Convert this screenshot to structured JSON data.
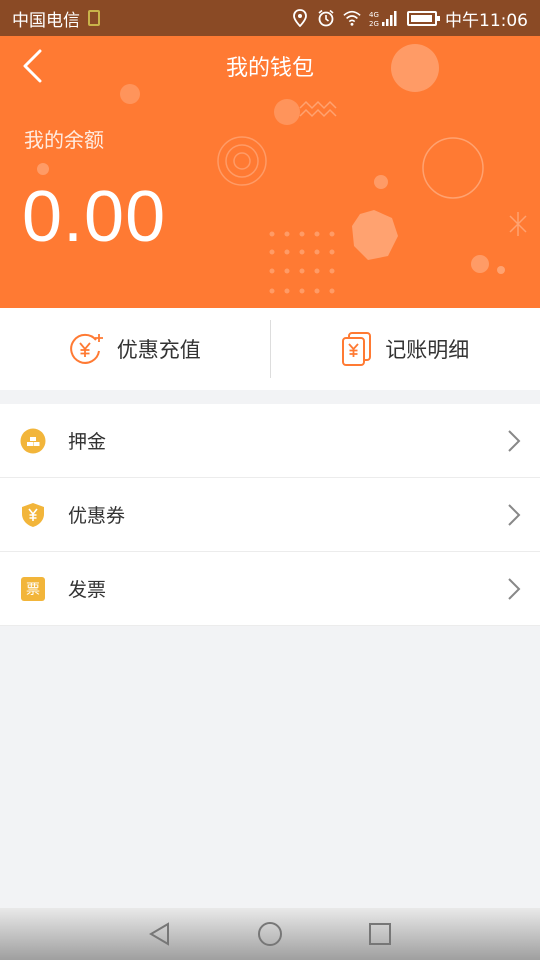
{
  "status_bar": {
    "carrier": "中国电信",
    "time": "中午11:06"
  },
  "header": {
    "title": "我的钱包",
    "balance_label": "我的余额",
    "balance_value": "0.00"
  },
  "actions": [
    {
      "label": "优惠充值",
      "icon": "yuan-sparkle-icon"
    },
    {
      "label": "记账明细",
      "icon": "bill-icon"
    }
  ],
  "list": [
    {
      "label": "押金",
      "icon": "deposit-icon"
    },
    {
      "label": "优惠券",
      "icon": "coupon-shield-icon"
    },
    {
      "label": "发票",
      "icon": "invoice-icon",
      "icon_text": "票"
    }
  ],
  "colors": {
    "accent": "#ff7a33",
    "status_bar": "#8a4a25",
    "icon_yellow": "#f2b53a"
  }
}
